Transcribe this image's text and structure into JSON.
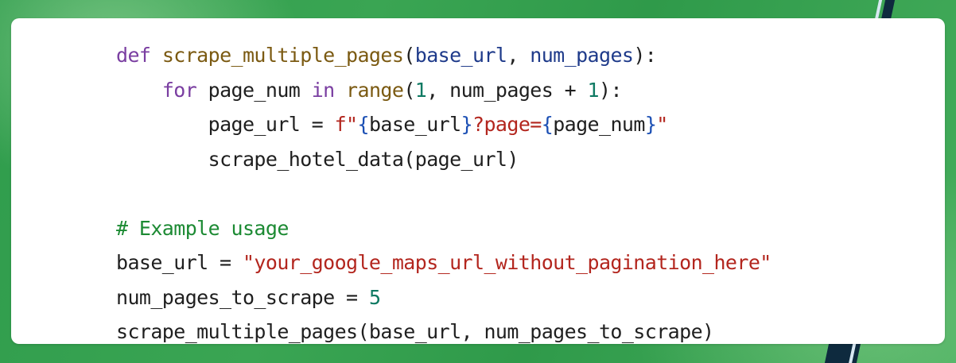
{
  "code": {
    "line1": {
      "kw_def": "def",
      "fn_name": "scrape_multiple_pages",
      "open": "(",
      "param1": "base_url",
      "sep": ", ",
      "param2": "num_pages",
      "close": "):"
    },
    "line2": {
      "indent": "    ",
      "kw_for": "for",
      "var": " page_num ",
      "kw_in": "in",
      "sp": " ",
      "fn_range": "range",
      "open": "(",
      "num1": "1",
      "mid": ", num_pages + ",
      "num2": "1",
      "close": "):"
    },
    "line3": {
      "indent": "        ",
      "lhs": "page_url = ",
      "prefix": "f\"",
      "brace_open1": "{",
      "expr1": "base_url",
      "brace_close1": "}",
      "literal": "?page=",
      "brace_open2": "{",
      "expr2": "page_num",
      "brace_close2": "}",
      "quote_end": "\""
    },
    "line4": {
      "indent": "        ",
      "text": "scrape_hotel_data(page_url)"
    },
    "line5": {
      "text": ""
    },
    "line6": {
      "comment": "# Example usage"
    },
    "line7": {
      "lhs": "base_url = ",
      "string": "\"your_google_maps_url_without_pagination_here\""
    },
    "line8": {
      "lhs": "num_pages_to_scrape = ",
      "num": "5"
    },
    "line9": {
      "text": "scrape_multiple_pages(base_url, num_pages_to_scrape)"
    }
  },
  "colors": {
    "keyword": "#7a3ea1",
    "function": "#7b5a12",
    "parameter": "#1e3a8a",
    "number": "#0f7a63",
    "string": "#b3261e",
    "brace": "#1b4fb4",
    "comment": "#1c8a33",
    "background": "#2e9a4a"
  }
}
